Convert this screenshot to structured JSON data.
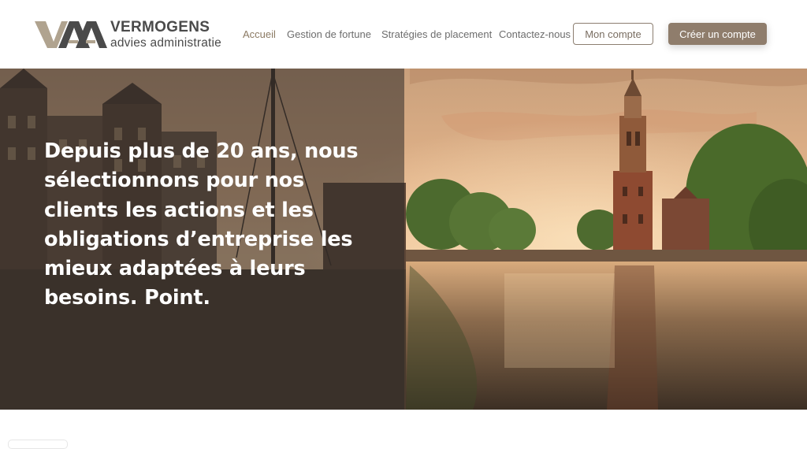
{
  "brand": {
    "name": "VERMOGENS",
    "subtitle": "advies administratie",
    "logo_icon": "vaa-monogram-icon",
    "colors": {
      "logo_dark": "#4a4a4a",
      "logo_tan": "#b0a38f",
      "accent": "#8f7d6c"
    }
  },
  "nav": {
    "items": [
      {
        "label": "Accueil",
        "active": true
      },
      {
        "label": "Gestion de fortune",
        "active": false
      },
      {
        "label": "Stratégies de placement",
        "active": false
      },
      {
        "label": "Contactez-nous",
        "active": false
      }
    ],
    "account_button": "Mon compte",
    "create_account_button": "Créer un compte"
  },
  "hero": {
    "headline": "Depuis plus de 20 ans, nous sélectionnons pour nos clients les actions et les obligations d’entreprise les mieux adaptées à leurs besoins. Point.",
    "image": "amsterdam-canal-sunset-photo"
  }
}
